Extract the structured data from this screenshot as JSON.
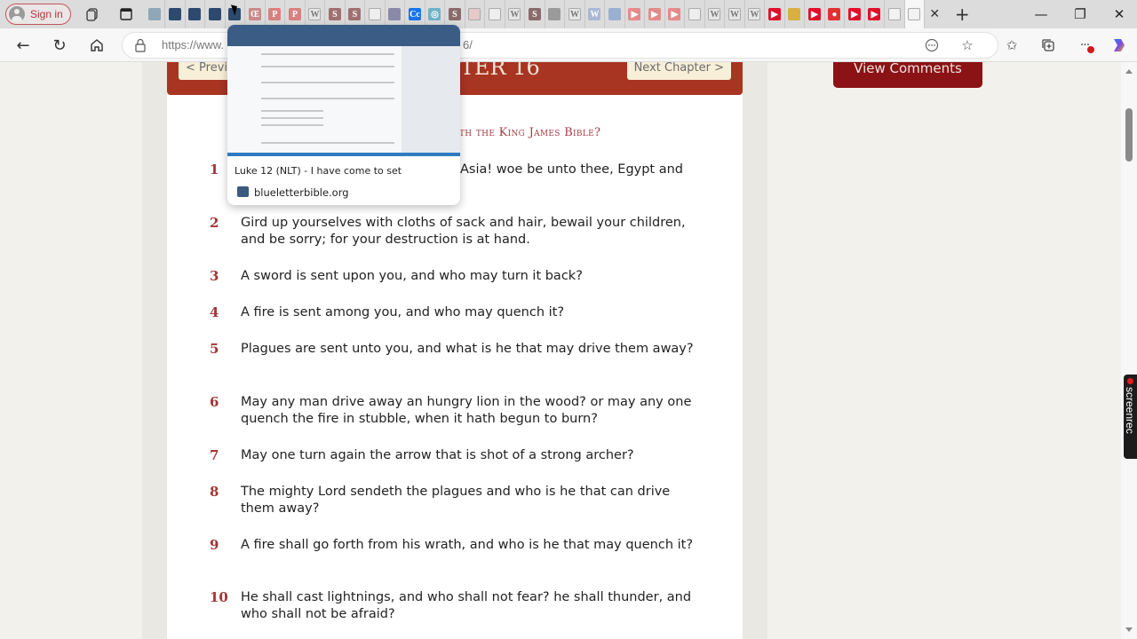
{
  "browser": {
    "signin_label": "Sign in",
    "tab_favicons": [
      {
        "name": "blb",
        "color": "#8fa7b8",
        "glyph": ""
      },
      {
        "name": "blb",
        "color": "#2c4a6e",
        "glyph": ""
      },
      {
        "name": "blb",
        "color": "#2c4a6e",
        "glyph": ""
      },
      {
        "name": "blb",
        "color": "#2c4a6e",
        "glyph": ""
      },
      {
        "name": "blb",
        "color": "#2c4a6e",
        "glyph": ""
      },
      {
        "name": "oe",
        "color": "#c98a8a",
        "glyph": "Œ"
      },
      {
        "name": "pdf",
        "color": "#d98080",
        "glyph": "P"
      },
      {
        "name": "pdf",
        "color": "#d98080",
        "glyph": "P"
      },
      {
        "name": "wiki",
        "color": "#e6e6e6",
        "glyph": "W"
      },
      {
        "name": "s",
        "color": "#a07070",
        "glyph": "S"
      },
      {
        "name": "s",
        "color": "#a07070",
        "glyph": "S"
      },
      {
        "name": "doc",
        "color": "#eeeeee",
        "glyph": ""
      },
      {
        "name": "img",
        "color": "#8a8aa8",
        "glyph": ""
      },
      {
        "name": "cc",
        "color": "#1a73e8",
        "glyph": "Cc"
      },
      {
        "name": "circle",
        "color": "#6fb3c9",
        "glyph": "◎"
      },
      {
        "name": "s",
        "color": "#8a6a6a",
        "glyph": "S"
      },
      {
        "name": "grid",
        "color": "#e6c9c9",
        "glyph": ""
      },
      {
        "name": "doc",
        "color": "#eeeeee",
        "glyph": ""
      },
      {
        "name": "wiki",
        "color": "#e6e6e6",
        "glyph": "W"
      },
      {
        "name": "s",
        "color": "#8a6a6a",
        "glyph": "S"
      },
      {
        "name": "eye",
        "color": "#9a9a9a",
        "glyph": ""
      },
      {
        "name": "wiki",
        "color": "#e6e6e6",
        "glyph": "W"
      },
      {
        "name": "wiki",
        "color": "#aab8d6",
        "glyph": "W"
      },
      {
        "name": "bird",
        "color": "#9ab0d0",
        "glyph": ""
      },
      {
        "name": "yt",
        "color": "#e58a8a",
        "glyph": "▶"
      },
      {
        "name": "yt",
        "color": "#e58a8a",
        "glyph": "▶"
      },
      {
        "name": "yt",
        "color": "#e58a8a",
        "glyph": "▶"
      },
      {
        "name": "doc",
        "color": "#eeeeee",
        "glyph": ""
      },
      {
        "name": "wiki",
        "color": "#e6e6e6",
        "glyph": "W"
      },
      {
        "name": "wiki",
        "color": "#e6e6e6",
        "glyph": "W"
      },
      {
        "name": "wiki",
        "color": "#e6e6e6",
        "glyph": "W"
      },
      {
        "name": "yt",
        "color": "#e0102a",
        "glyph": "▶"
      },
      {
        "name": "temple",
        "color": "#d8b040",
        "glyph": ""
      },
      {
        "name": "yt",
        "color": "#e0102a",
        "glyph": "▶"
      },
      {
        "name": "rec",
        "color": "#e33030",
        "glyph": "●"
      },
      {
        "name": "yt",
        "color": "#e0102a",
        "glyph": "▶"
      },
      {
        "name": "yt",
        "color": "#e0102a",
        "glyph": "▶"
      },
      {
        "name": "doc",
        "color": "#f2f2f2",
        "glyph": ""
      },
      {
        "name": "doc-active",
        "color": "#f2f2f2",
        "glyph": ""
      }
    ],
    "url_start": "https://www.",
    "url_end": "6/"
  },
  "tab_preview": {
    "title": "Luke 12 (NLT) - I have come to set",
    "site": "blueletterbible.org"
  },
  "page": {
    "prev_label": "< Previ",
    "chapter_title": "TER 16",
    "next_label": "Next Chapter >",
    "subtitle": "th the King James Bible?",
    "view_comments_label": "View Comments",
    "verses": [
      {
        "num": "1",
        "text": "Asia! woe be unto thee, Egypt and"
      },
      {
        "num": "2",
        "text": "Gird up yourselves with cloths of sack and hair, bewail your children, and be sorry; for your destruction is at hand."
      },
      {
        "num": "3",
        "text": "A sword is sent upon you, and who may turn it back?"
      },
      {
        "num": "4",
        "text": "A fire is sent among you, and who may quench it?"
      },
      {
        "num": "5",
        "text": "Plagues are sent unto you, and what is he that may drive them away?"
      },
      {
        "num": "6",
        "text": "May any man drive away an hungry lion in the wood? or may any one quench the fire in stubble, when it hath begun to burn?"
      },
      {
        "num": "7",
        "text": "May one turn again the arrow that is shot of a strong archer?"
      },
      {
        "num": "8",
        "text": "The mighty Lord sendeth the plagues and who is he that can drive them away?"
      },
      {
        "num": "9",
        "text": "A fire shall go forth from his wrath, and who is he that may quench it?"
      },
      {
        "num": "10",
        "text": "He shall cast lightnings, and who shall not fear? he shall thunder, and who shall not be afraid?"
      }
    ]
  },
  "overlay": {
    "screenrec_label": "screenrec"
  },
  "colors": {
    "header_red": "#a83422",
    "comments_red": "#8b1215",
    "verse_num": "#a33535"
  }
}
